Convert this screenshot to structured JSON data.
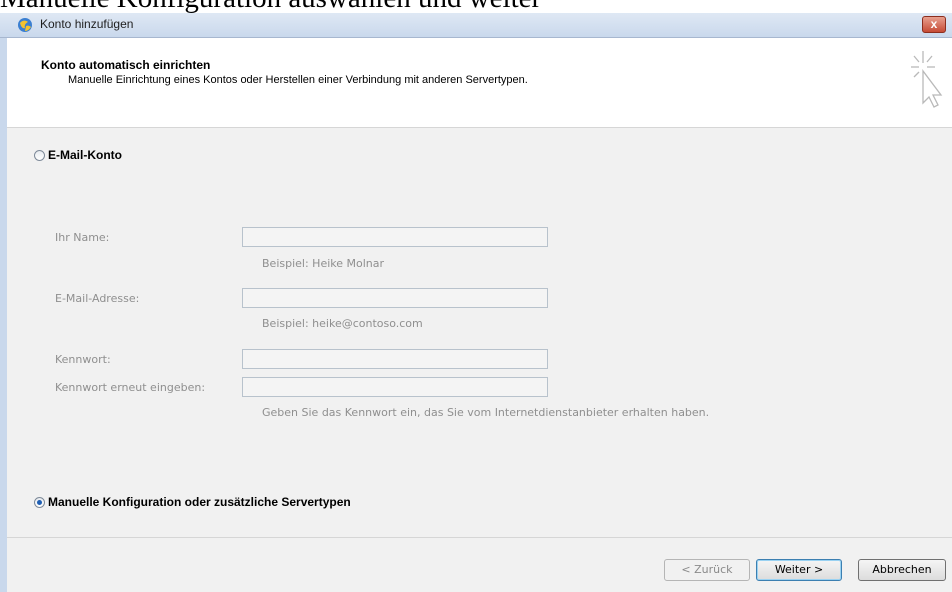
{
  "caption": "Manuelle Konfiguration auswählen und weiter",
  "window": {
    "title": "Konto hinzufügen",
    "close_label": "x",
    "app_icon": "outlook-globe-icon"
  },
  "header": {
    "title": "Konto automatisch einrichten",
    "subtitle": "Manuelle Einrichtung eines Kontos oder Herstellen einer Verbindung mit anderen Servertypen.",
    "decor_icon": "cursor-sparkle-icon"
  },
  "options": {
    "email_account_label": "E-Mail-Konto",
    "email_account_selected": false,
    "manual_config_label": "Manuelle Konfiguration oder zusätzliche Servertypen",
    "manual_config_selected": true
  },
  "form": {
    "name_label": "Ihr Name:",
    "name_value": "",
    "name_hint": "Beispiel: Heike Molnar",
    "email_label": "E-Mail-Adresse:",
    "email_value": "",
    "email_hint": "Beispiel: heike@contoso.com",
    "password_label": "Kennwort:",
    "password_value": "",
    "password_repeat_label": "Kennwort erneut eingeben:",
    "password_repeat_value": "",
    "password_hint": "Geben Sie das Kennwort ein, das Sie vom Internetdienstanbieter erhalten haben."
  },
  "buttons": {
    "back": "< Zurück",
    "next": "Weiter >",
    "cancel": "Abbrechen"
  },
  "colors": {
    "titlebar": "#c9d8ec",
    "close": "#c64b35",
    "disabled_text": "#8f8f8f",
    "radio_dot": "#1f5fb3"
  }
}
